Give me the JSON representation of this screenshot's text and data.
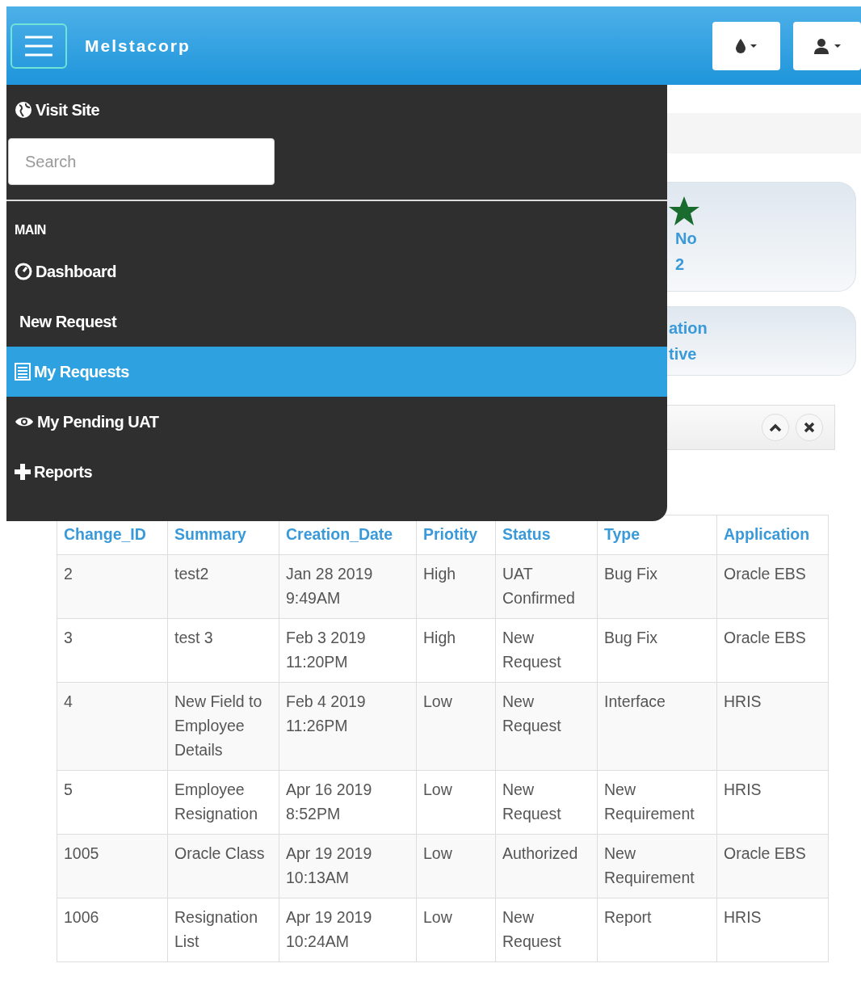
{
  "navbar": {
    "brand": "Melstacorp",
    "buttons": [
      {
        "kind": "theme"
      },
      {
        "kind": "user"
      }
    ]
  },
  "cards": [
    {
      "kind": "emp_no",
      "label": "No",
      "value": "2"
    },
    {
      "kind": "plain",
      "label": "ation",
      "value": "tive"
    }
  ],
  "table": {
    "columns": [
      "Change_ID",
      "Summary",
      "Creation_Date",
      "Priotity",
      "Status",
      "Type",
      "Application"
    ],
    "rows": [
      [
        "2",
        "test2",
        "Jan 28 2019 9:49AM",
        "High",
        "UAT Confirmed",
        "Bug Fix",
        "Oracle EBS"
      ],
      [
        "3",
        "test 3",
        "Feb 3 2019 11:20PM",
        "High",
        "New Request",
        "Bug Fix",
        "Oracle EBS"
      ],
      [
        "4",
        "New Field to Employee Details",
        "Feb 4 2019 11:26PM",
        "Low",
        "New Request",
        "Interface",
        "HRIS"
      ],
      [
        "5",
        "Employee Resignation",
        "Apr 16 2019 8:52PM",
        "Low",
        "New Request",
        "New Requirement",
        "HRIS"
      ],
      [
        "1005",
        "Oracle Class",
        "Apr 19 2019 10:13AM",
        "Low",
        "Authorized",
        "New Requirement",
        "Oracle EBS"
      ],
      [
        "1006",
        "Resignation List",
        "Apr 19 2019 10:24AM",
        "Low",
        "New Request",
        "Report",
        "HRIS"
      ]
    ]
  },
  "menu": {
    "visit_site": "Visit Site",
    "search": {
      "placeholder": "Search"
    },
    "section": "MAIN",
    "items": [
      {
        "kind": "dashboard",
        "label": "Dashboard",
        "selected": false
      },
      {
        "kind": "plain",
        "label": "New Request",
        "selected": false
      },
      {
        "kind": "list",
        "label": "My Requests",
        "selected": true
      },
      {
        "kind": "eye",
        "label": "My Pending UAT",
        "selected": false
      },
      {
        "kind": "plus",
        "label": "Reports",
        "selected": false
      }
    ]
  }
}
